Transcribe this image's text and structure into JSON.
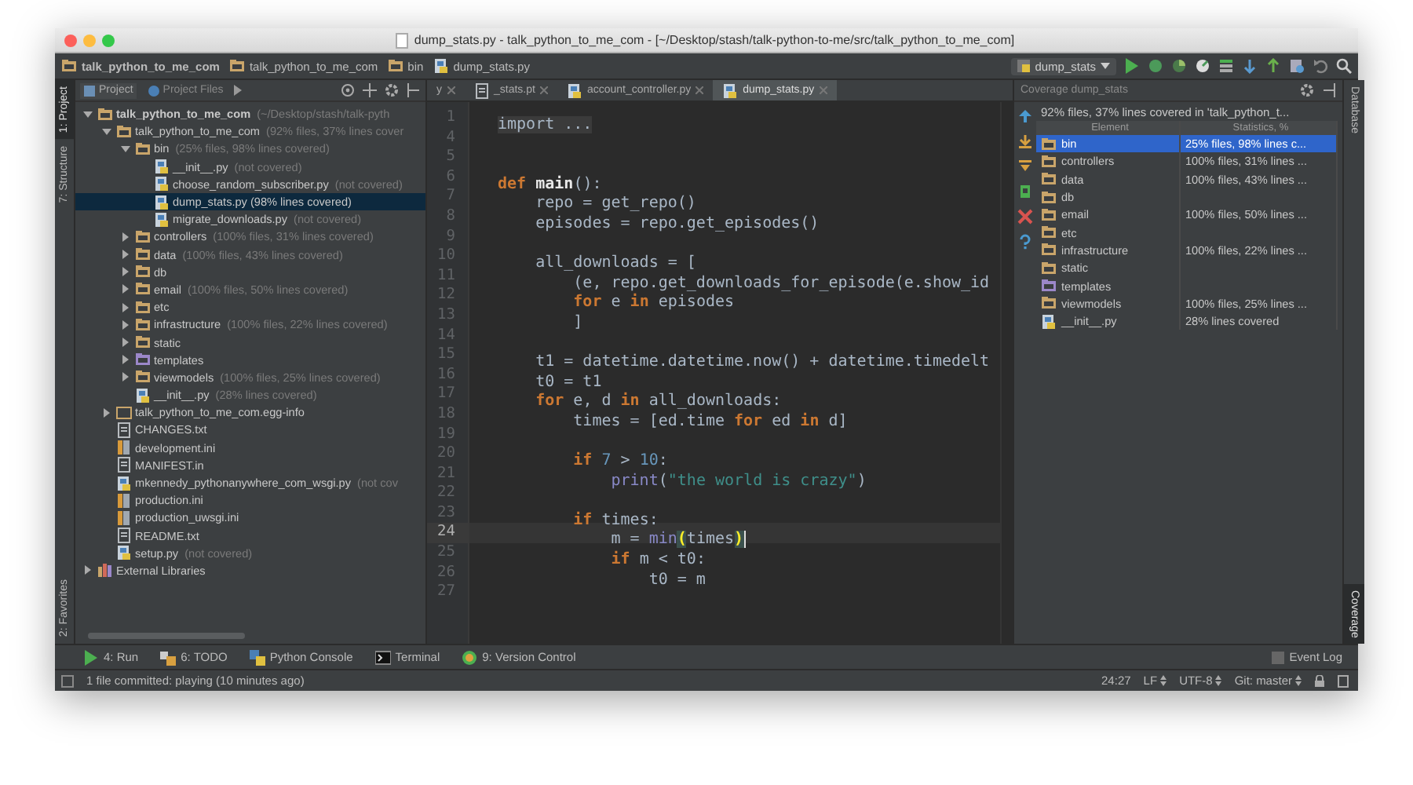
{
  "window": {
    "title": "dump_stats.py - talk_python_to_me_com - [~/Desktop/stash/talk-python-to-me/src/talk_python_to_me_com]"
  },
  "breadcrumbs": [
    {
      "label": "talk_python_to_me_com",
      "kind": "module"
    },
    {
      "label": "talk_python_to_me_com",
      "kind": "folder"
    },
    {
      "label": "bin",
      "kind": "folder"
    },
    {
      "label": "dump_stats.py",
      "kind": "py"
    }
  ],
  "run_config": "dump_stats",
  "left_stripe": {
    "top": [
      {
        "label": "1: Project",
        "selected": true
      },
      {
        "label": "7: Structure",
        "selected": false
      }
    ],
    "bottom": [
      {
        "label": "2: Favorites",
        "selected": false
      }
    ]
  },
  "project": {
    "tabs": [
      {
        "label": "Project",
        "selected": true
      },
      {
        "label": "Project Files",
        "selected": false
      }
    ],
    "tree": [
      {
        "name": "talk_python_to_me_com",
        "note": "(~/Desktop/stash/talk-pyth",
        "kind": "module",
        "expanded": true,
        "selected": false,
        "children": [
          {
            "name": "talk_python_to_me_com",
            "note": "(92% files, 37% lines cover",
            "kind": "folder",
            "expanded": true,
            "selected": false,
            "children": [
              {
                "name": "bin",
                "note": "(25% files, 98% lines covered)",
                "kind": "folder",
                "expanded": true,
                "selected": false,
                "children": [
                  {
                    "name": "__init__.py",
                    "note": "(not covered)",
                    "kind": "py",
                    "selected": false
                  },
                  {
                    "name": "choose_random_subscriber.py",
                    "note": "(not covered)",
                    "kind": "py",
                    "selected": false
                  },
                  {
                    "name": "dump_stats.py (98% lines covered)",
                    "kind": "py",
                    "selected": true
                  },
                  {
                    "name": "migrate_downloads.py",
                    "note": "(not covered)",
                    "kind": "py",
                    "selected": false
                  }
                ]
              },
              {
                "name": "controllers",
                "note": "(100% files, 31% lines covered)",
                "kind": "folder",
                "expanded": false,
                "selected": false
              },
              {
                "name": "data",
                "note": "(100% files, 43% lines covered)",
                "kind": "folder",
                "expanded": false,
                "selected": false
              },
              {
                "name": "db",
                "kind": "folder",
                "expanded": false,
                "selected": false
              },
              {
                "name": "email",
                "note": "(100% files, 50% lines covered)",
                "kind": "folder",
                "expanded": false,
                "selected": false
              },
              {
                "name": "etc",
                "kind": "folder",
                "expanded": false,
                "selected": false
              },
              {
                "name": "infrastructure",
                "note": "(100% files, 22% lines covered)",
                "kind": "folder",
                "expanded": false,
                "selected": false
              },
              {
                "name": "static",
                "kind": "folder",
                "expanded": false,
                "selected": false
              },
              {
                "name": "templates",
                "kind": "templates",
                "expanded": false,
                "selected": false
              },
              {
                "name": "viewmodels",
                "note": "(100% files, 25% lines covered)",
                "kind": "folder",
                "expanded": false,
                "selected": false
              },
              {
                "name": "__init__.py",
                "note": "(28% lines covered)",
                "kind": "py",
                "selected": false
              }
            ]
          },
          {
            "name": "talk_python_to_me_com.egg-info",
            "kind": "plainfolder",
            "expanded": false,
            "selected": false
          },
          {
            "name": "CHANGES.txt",
            "kind": "txt",
            "selected": false
          },
          {
            "name": "development.ini",
            "kind": "ini",
            "selected": false
          },
          {
            "name": "MANIFEST.in",
            "kind": "txt",
            "selected": false
          },
          {
            "name": "mkennedy_pythonanywhere_com_wsgi.py",
            "note": "(not cov",
            "kind": "py",
            "selected": false
          },
          {
            "name": "production.ini",
            "kind": "ini",
            "selected": false
          },
          {
            "name": "production_uwsgi.ini",
            "kind": "ini",
            "selected": false
          },
          {
            "name": "README.txt",
            "kind": "txt",
            "selected": false
          },
          {
            "name": "setup.py",
            "note": "(not covered)",
            "kind": "py",
            "selected": false
          }
        ]
      },
      {
        "name": "External Libraries",
        "kind": "lib",
        "expanded": false,
        "selected": false
      }
    ]
  },
  "editor": {
    "tabs": [
      {
        "label": "y",
        "selected": false
      },
      {
        "label": "_stats.pt",
        "kind": "txt",
        "selected": false
      },
      {
        "label": "account_controller.py",
        "kind": "py",
        "selected": false
      },
      {
        "label": "dump_stats.py",
        "kind": "py",
        "selected": true
      }
    ],
    "lines": [
      {
        "number": "1",
        "current": false,
        "tokens": [
          {
            "kind": "fold",
            "text": "import ..."
          }
        ]
      },
      {
        "number": "4",
        "current": false
      },
      {
        "number": "5",
        "current": false
      },
      {
        "number": "6",
        "current": false,
        "tokens": [
          {
            "kind": "kw",
            "text": "def "
          },
          {
            "kind": "fn",
            "text": "main"
          },
          {
            "kind": "plain",
            "text": "():"
          }
        ]
      },
      {
        "number": "7",
        "current": false,
        "tokens": [
          {
            "kind": "plain",
            "text": "    repo = get_repo()"
          }
        ]
      },
      {
        "number": "8",
        "current": false,
        "tokens": [
          {
            "kind": "plain",
            "text": "    episodes = repo.get_episodes()"
          }
        ]
      },
      {
        "number": "9",
        "current": false
      },
      {
        "number": "10",
        "current": false,
        "tokens": [
          {
            "kind": "plain",
            "text": "    all_downloads = ["
          }
        ]
      },
      {
        "number": "11",
        "current": false,
        "tokens": [
          {
            "kind": "plain",
            "text": "        (e, repo.get_downloads_for_episode(e.show_id"
          }
        ]
      },
      {
        "number": "12",
        "current": false,
        "tokens": [
          {
            "kind": "kw",
            "text": "        for"
          },
          {
            "kind": "plain",
            "text": " e "
          },
          {
            "kind": "kw",
            "text": "in"
          },
          {
            "kind": "plain",
            "text": " episodes"
          }
        ]
      },
      {
        "number": "13",
        "current": false,
        "tokens": [
          {
            "kind": "plain",
            "text": "        ]"
          }
        ]
      },
      {
        "number": "14",
        "current": false
      },
      {
        "number": "15",
        "current": false,
        "tokens": [
          {
            "kind": "plain",
            "text": "    t1 = datetime.datetime.now() + datetime.timedelt"
          }
        ]
      },
      {
        "number": "16",
        "current": false,
        "tokens": [
          {
            "kind": "plain",
            "text": "    t0 = t1"
          }
        ]
      },
      {
        "number": "17",
        "current": false,
        "tokens": [
          {
            "kind": "kw",
            "text": "    for"
          },
          {
            "kind": "plain",
            "text": " e, d "
          },
          {
            "kind": "kw",
            "text": "in"
          },
          {
            "kind": "plain",
            "text": " all_downloads:"
          }
        ]
      },
      {
        "number": "18",
        "current": false,
        "tokens": [
          {
            "kind": "plain",
            "text": "        times = [ed.time "
          },
          {
            "kind": "kw",
            "text": "for"
          },
          {
            "kind": "plain",
            "text": " ed "
          },
          {
            "kind": "kw",
            "text": "in"
          },
          {
            "kind": "plain",
            "text": " d]"
          }
        ]
      },
      {
        "number": "19",
        "current": false
      },
      {
        "number": "20",
        "current": false,
        "tokens": [
          {
            "kind": "kw",
            "text": "        if "
          },
          {
            "kind": "num",
            "text": "7"
          },
          {
            "kind": "plain",
            "text": " > "
          },
          {
            "kind": "num",
            "text": "10"
          },
          {
            "kind": "plain",
            "text": ":"
          }
        ]
      },
      {
        "number": "21",
        "current": false,
        "tokens": [
          {
            "kind": "builtin",
            "text": "            print"
          },
          {
            "kind": "plain",
            "text": "("
          },
          {
            "kind": "str",
            "text": "\"the world is crazy\""
          },
          {
            "kind": "plain",
            "text": ")"
          }
        ]
      },
      {
        "number": "22",
        "current": false
      },
      {
        "number": "23",
        "current": false,
        "tokens": [
          {
            "kind": "kw",
            "text": "        if"
          },
          {
            "kind": "plain",
            "text": " times:"
          }
        ]
      },
      {
        "number": "24",
        "current": true,
        "tokens": [
          {
            "kind": "plain",
            "text": "            m = "
          },
          {
            "kind": "builtin",
            "text": "min"
          },
          {
            "kind": "match",
            "text": "("
          },
          {
            "kind": "plain",
            "text": "times"
          },
          {
            "kind": "match",
            "text": ")"
          }
        ]
      },
      {
        "number": "25",
        "current": false,
        "tokens": [
          {
            "kind": "kw",
            "text": "            if"
          },
          {
            "kind": "plain",
            "text": " m < t0:"
          }
        ]
      },
      {
        "number": "26",
        "current": false,
        "tokens": [
          {
            "kind": "plain",
            "text": "                t0 = m"
          }
        ]
      },
      {
        "number": "27",
        "current": false
      }
    ]
  },
  "coverage": {
    "title": "Coverage dump_stats",
    "summary": "92% files, 37% lines covered in 'talk_python_t...",
    "columns": [
      "Element",
      "Statistics, %"
    ],
    "rows": [
      {
        "element": "bin",
        "statistics": "25% files, 98% lines c...",
        "kind": "folder",
        "selected": true
      },
      {
        "element": "controllers",
        "statistics": "100% files, 31% lines ...",
        "kind": "folder",
        "selected": false
      },
      {
        "element": "data",
        "statistics": "100% files, 43% lines ...",
        "kind": "folder",
        "selected": false
      },
      {
        "element": "db",
        "kind": "folder",
        "selected": false
      },
      {
        "element": "email",
        "statistics": "100% files, 50% lines ...",
        "kind": "folder",
        "selected": false
      },
      {
        "element": "etc",
        "kind": "folder",
        "selected": false
      },
      {
        "element": "infrastructure",
        "statistics": "100% files, 22% lines ...",
        "kind": "folder",
        "selected": false
      },
      {
        "element": "static",
        "kind": "folder",
        "selected": false
      },
      {
        "element": "templates",
        "kind": "templates",
        "selected": false
      },
      {
        "element": "viewmodels",
        "statistics": "100% files, 25% lines ...",
        "kind": "folder",
        "selected": false
      },
      {
        "element": "__init__.py",
        "statistics": "28% lines covered",
        "kind": "py",
        "selected": false
      }
    ]
  },
  "right_stripe": [
    {
      "label": "Database",
      "selected": false
    },
    {
      "label": "Coverage",
      "selected": true
    }
  ],
  "tool_windows": [
    {
      "label": "4: Run",
      "kind": "run"
    },
    {
      "label": "6: TODO",
      "kind": "todo"
    },
    {
      "label": "Python Console",
      "kind": "console"
    },
    {
      "label": "Terminal",
      "kind": "terminal"
    },
    {
      "label": "9: Version Control",
      "kind": "vcs"
    }
  ],
  "event_log": "Event Log",
  "status_bar": {
    "message": "1 file committed: playing (10 minutes ago)",
    "position": "24:27",
    "line_separator": "LF",
    "encoding": "UTF-8",
    "vcs_branch": "Git: master"
  }
}
